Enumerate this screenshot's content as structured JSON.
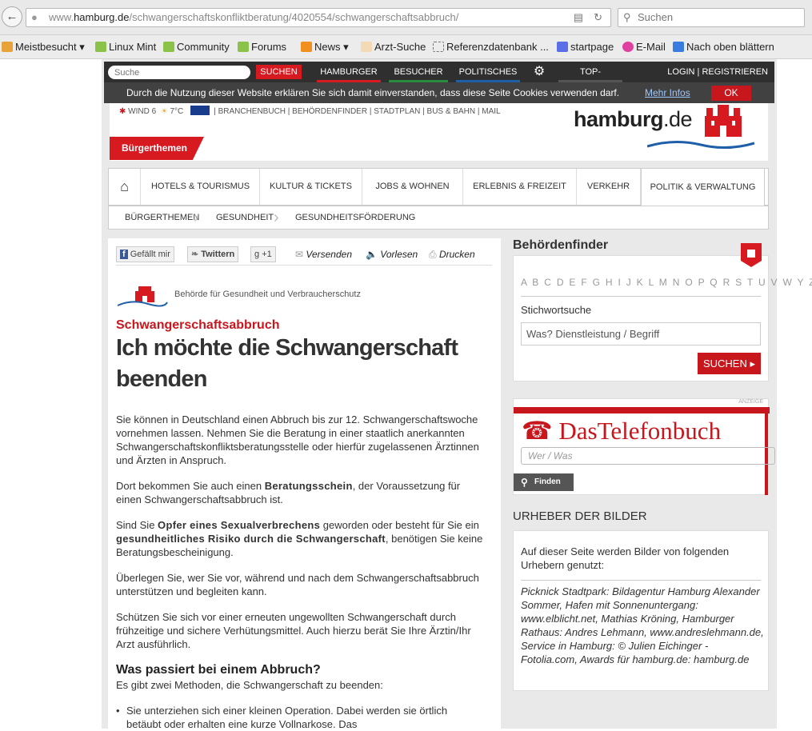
{
  "browser": {
    "url_prefix": "www.",
    "url_domain": "hamburg.de",
    "url_path": "/schwangerschaftskonfliktberatung/4020554/schwangerschaftsabbruch/",
    "search_placeholder": "Suchen",
    "bookmarks": [
      "Meistbesucht",
      "Linux Mint",
      "Community",
      "Forums",
      "News",
      "Arzt-Suche",
      "Referenzdatenbank ...",
      "startpage",
      "E-Mail",
      "Nach oben blättern"
    ]
  },
  "topnav": {
    "search_placeholder": "Suche",
    "search_button": "SUCHEN",
    "tabs": [
      "HAMBURGER",
      "BESUCHER",
      "POLITISCHES",
      "TOP-SERVICES"
    ],
    "tab_colors": [
      "#d71920",
      "#2a8a3e",
      "#1f5fa8",
      "#555555"
    ],
    "login": "LOGIN",
    "register": "REGISTRIEREN"
  },
  "cookie": {
    "text": "Durch die Nutzung dieser Website erklären Sie sich damit einverstanden, dass diese Seite Cookies verwenden darf.",
    "more": "Mehr Infos",
    "ok": "OK"
  },
  "header": {
    "weather": "WIND 6",
    "temp": "7°C",
    "links": "BRANCHENBUCH | BEHÖRDENFINDER | STADTPLAN | BUS & BAHN | MAIL",
    "logo_main": "hamburg",
    "logo_tld": ".de",
    "section": "Bürgerthemen"
  },
  "mainnav": [
    "HOTELS & TOURISMUS",
    "KULTUR & TICKETS",
    "JOBS & WOHNEN",
    "ERLEBNIS & FREIZEIT",
    "VERKEHR",
    "POLITIK & VERWALTUNG"
  ],
  "breadcrumb": [
    "BÜRGERTHEMEN",
    "GESUNDHEIT",
    "GESUNDHEITSFÖRDERUNG"
  ],
  "social": {
    "like": "Gefällt mir",
    "tweet": "Twittern",
    "plus": "+1",
    "send": "Versenden",
    "read": "Vorlesen",
    "print": "Drucken"
  },
  "article": {
    "authority": "Behörde für Gesundheit und Verbraucherschutz",
    "kicker": "Schwangerschaftsabbruch",
    "title": "Ich möchte die Schwangerschaft beenden",
    "p1": "Sie können in Deutschland einen Abbruch bis zur 12. Schwangerschaftswoche vornehmen lassen. Nehmen Sie die Beratung in einer staatlich anerkannten Schwangerschaftskonfliktsberatungsstelle oder hierfür zugelassenen Ärztinnen und Ärzten in Anspruch.",
    "p2a": "Dort bekommen Sie auch einen ",
    "p2b": "Beratungsschein",
    "p2c": ", der Voraussetzung für einen Schwangerschaftsabbruch ist.",
    "p3a": "Sind Sie ",
    "p3b": "Opfer eines Sexualverbrechens",
    "p3c": " geworden oder besteht für Sie ein ",
    "p3d": "gesundheitliches Risiko durch die Schwangerschaft",
    "p3e": ", benötigen Sie keine Beratungsbescheinigung.",
    "p4": "Überlegen Sie, wer Sie vor, während und nach dem Schwangerschaftsabbruch unterstützen und begleiten kann.",
    "p5": "Schützen Sie sich vor einer erneuten ungewollten Schwangerschaft durch frühzeitige und sichere Verhütungsmittel. Auch hierzu berät Sie Ihre Ärztin/Ihr Arzt ausführlich.",
    "h3": "Was passiert bei einem Abbruch?",
    "p6": "Es gibt zwei Methoden, die Schwangerschaft zu beenden:",
    "li1": "Sie unterziehen sich einer kleinen Operation. Dabei werden sie örtlich betäubt oder erhalten eine kurze Vollnarkose. Das"
  },
  "behoerdenfinder": {
    "title": "Behördenfinder",
    "alphabet": "A B C D E F G H I J K L M N O P Q R S T U V W Y Z",
    "label": "Stichwortsuche",
    "placeholder": "Was? Dienstleistung / Begriff",
    "button": "SUCHEN"
  },
  "telefonbuch": {
    "ad": "ANZEIGE",
    "name": "DasTelefonbuch",
    "placeholder": "Wer / Was",
    "button": "Finden"
  },
  "urheber": {
    "title": "URHEBER DER BILDER",
    "intro": "Auf dieser Seite werden Bilder von folgenden Urhebern genutzt:",
    "credits": "Picknick Stadtpark: Bildagentur Hamburg Alexander Sommer, Hafen mit Sonnenuntergang: www.elblicht.net, Mathias Kröning, Hamburger Rathaus: Andres Lehmann, www.andreslehmann.de, Service in Hamburg: © Julien Eichinger - Fotolia.com, Awards für hamburg.de: hamburg.de"
  }
}
